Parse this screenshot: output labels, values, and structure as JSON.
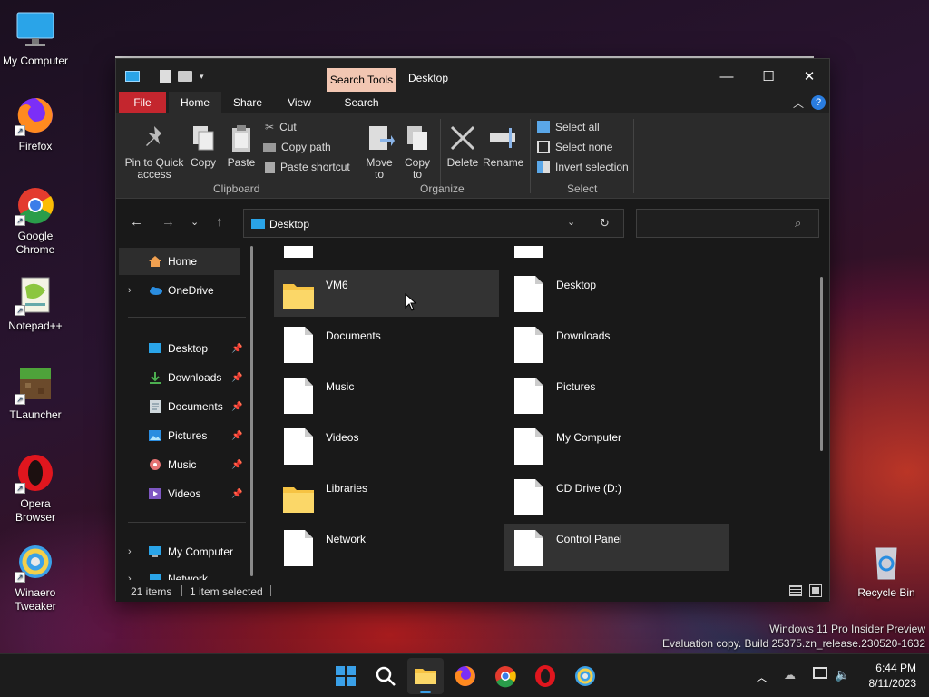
{
  "desktop": {
    "icons": [
      {
        "label": "My Computer",
        "icon": "monitor-icon"
      },
      {
        "label": "Firefox",
        "icon": "firefox-icon"
      },
      {
        "label": "Google Chrome",
        "icon": "chrome-icon"
      },
      {
        "label": "Notepad++",
        "icon": "notepadpp-icon"
      },
      {
        "label": "TLauncher",
        "icon": "tlauncher-icon"
      },
      {
        "label": "Opera Browser",
        "icon": "opera-icon"
      },
      {
        "label": "Winaero Tweaker",
        "icon": "winaero-icon"
      }
    ],
    "recycle_bin": "Recycle Bin",
    "watermark": {
      "line1": "Windows 11 Pro Insider Preview",
      "line2": "Evaluation copy. Build 25375.zn_release.230520-1632"
    }
  },
  "explorer": {
    "search_tools_label": "Search Tools",
    "title": "Desktop",
    "window_buttons": {
      "minimize": "—",
      "maximize": "☐",
      "close": "✕"
    },
    "tabs": [
      "File",
      "Home",
      "Share",
      "View",
      "Search"
    ],
    "ribbon": {
      "pin": "Pin to Quick access",
      "copy": "Copy",
      "paste": "Paste",
      "cut": "Cut",
      "copy_path": "Copy path",
      "paste_shortcut": "Paste shortcut",
      "clipboard_group": "Clipboard",
      "move_to": "Move to",
      "copy_to": "Copy to",
      "delete": "Delete",
      "rename": "Rename",
      "organize_group": "Organize",
      "select_all": "Select all",
      "select_none": "Select none",
      "invert_selection": "Invert selection",
      "select_group": "Select"
    },
    "address": {
      "location": "Desktop"
    },
    "search": {
      "placeholder": ""
    },
    "nav": {
      "home": "Home",
      "onedrive": "OneDrive",
      "quick": [
        "Desktop",
        "Downloads",
        "Documents",
        "Pictures",
        "Music",
        "Videos"
      ],
      "my_computer": "My Computer",
      "network": "Network"
    },
    "files": {
      "left": [
        "VM6",
        "Documents",
        "Music",
        "Videos",
        "Libraries",
        "Network"
      ],
      "right": [
        "Desktop",
        "Downloads",
        "Pictures",
        "My Computer",
        "CD Drive (D:)",
        "Control Panel"
      ]
    },
    "status": {
      "count": "21 items",
      "selected": "1 item selected"
    }
  },
  "taskbar": {
    "time": "6:44 PM",
    "date": "8/11/2023"
  },
  "colors": {
    "file_tab": "#c4262e",
    "search_tools": "#f2c6b2",
    "folder": "#f6c343",
    "accent": "#3aa0e8"
  }
}
